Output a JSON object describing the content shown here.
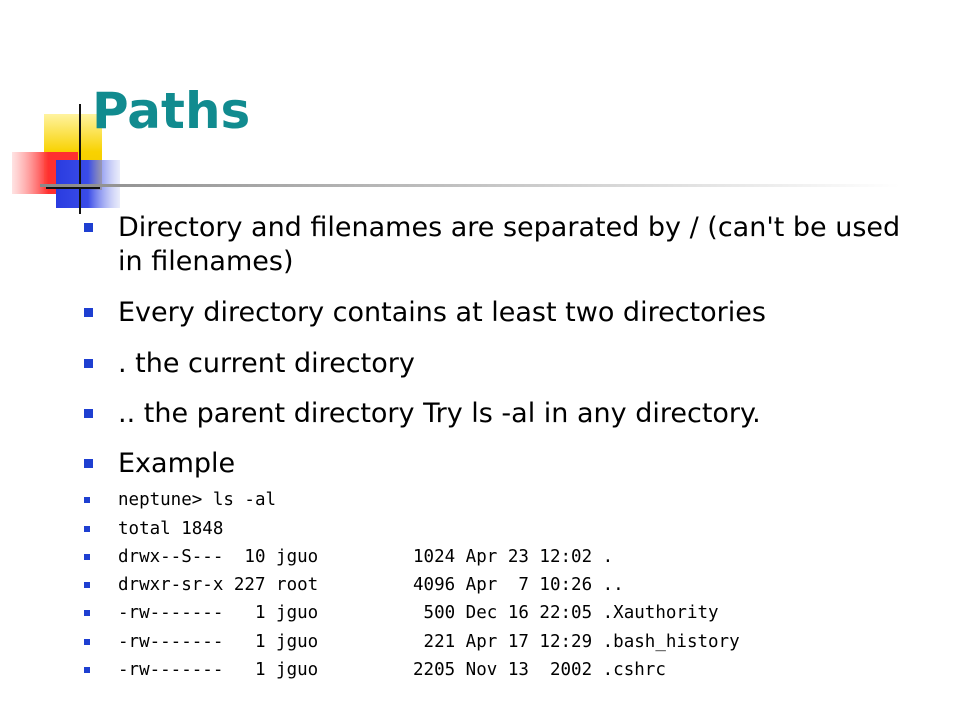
{
  "slide": {
    "title": "Paths",
    "bullets": [
      "Directory and filenames are separated by / (can't be used in filenames)",
      "Every directory contains at least two directories",
      ". the current directory",
      ".. the parent directory Try ls -al in any directory.",
      "Example"
    ],
    "code_lines": [
      "neptune> ls -al",
      "total 1848",
      "drwx--S---  10 jguo         1024 Apr 23 12:02 .",
      "drwxr-sr-x 227 root         4096 Apr  7 10:26 ..",
      "-rw-------   1 jguo          500 Dec 16 22:05 .Xauthority",
      "-rw-------   1 jguo          221 Apr 17 12:29 .bash_history",
      "-rw-------   1 jguo         2205 Nov 13  2002 .cshrc"
    ]
  },
  "theme": {
    "title_color": "#118b8f",
    "bullet_color": "#1e3fd1",
    "accent_yellow": "#f8d200",
    "accent_red": "#ff2a2a",
    "accent_blue": "#2a3ce0"
  }
}
